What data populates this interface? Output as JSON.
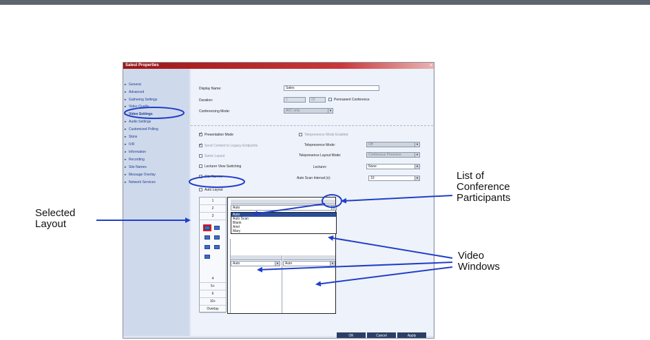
{
  "dialog": {
    "title": "Salesl Properties",
    "close_glyph": "×",
    "sidebar": [
      "General",
      "Advanced",
      "Gathering Settings",
      "Video Quality",
      "Video Settings",
      "Audio Settings",
      "Customized Polling",
      "Skins",
      "IVR",
      "Information",
      "Recording",
      "Site Names",
      "Message Overlay",
      "Network Services"
    ],
    "fields": {
      "display_name_label": "Display Name:",
      "display_name_value": "Sales",
      "duration_label": "Duration:",
      "duration_hours": "1",
      "duration_minutes": "00",
      "permanent_label": "Permanent Conference",
      "content_mode_label": "Conferencing Mode:",
      "content_mode_value": "AVC only"
    },
    "options": {
      "presentation_mode": "Presentation Mode",
      "send_content": "Send Content to Legacy Endpoints",
      "same_layout": "Same Layout",
      "lecturer_view": "Lecturer View Switching",
      "site_names": "Site Names",
      "auto_layout": "Auto Layout",
      "telepresence_enabled": "Telepresence Mode Enabled",
      "telepresence_mode_label": "Telepresence Mode:",
      "telepresence_mode_value": "Off",
      "telepresence_layout_label": "Telepresence Layout Mode:",
      "telepresence_layout_value": "Continuous Presence",
      "layout_label": "Lecturer:",
      "layout_value": "None",
      "auto_scan_label": "Auto Scan Interval (s):",
      "auto_scan_value": "10"
    },
    "layout_rows": [
      "1",
      "2",
      "3",
      "4",
      "5+",
      "6",
      "10+",
      "Overlay"
    ],
    "dropdown": {
      "value": "Auto",
      "items": [
        "Auto",
        "Auto Scan",
        "Blank",
        "Ariel",
        "Mary"
      ]
    },
    "video_windows": [
      "Auto",
      "Auto"
    ],
    "buttons": [
      "OK",
      "Cancel",
      "Apply"
    ]
  },
  "callouts": {
    "selected_layout": [
      "Selected",
      "Layout"
    ],
    "list_participants": [
      "List of",
      "Conference",
      "Participants"
    ],
    "video_windows": [
      "Video",
      "Windows"
    ]
  },
  "colors": {
    "annotation": "#1f3ec8",
    "highlight": "#e4161b",
    "titlebar": "#9b1616"
  }
}
